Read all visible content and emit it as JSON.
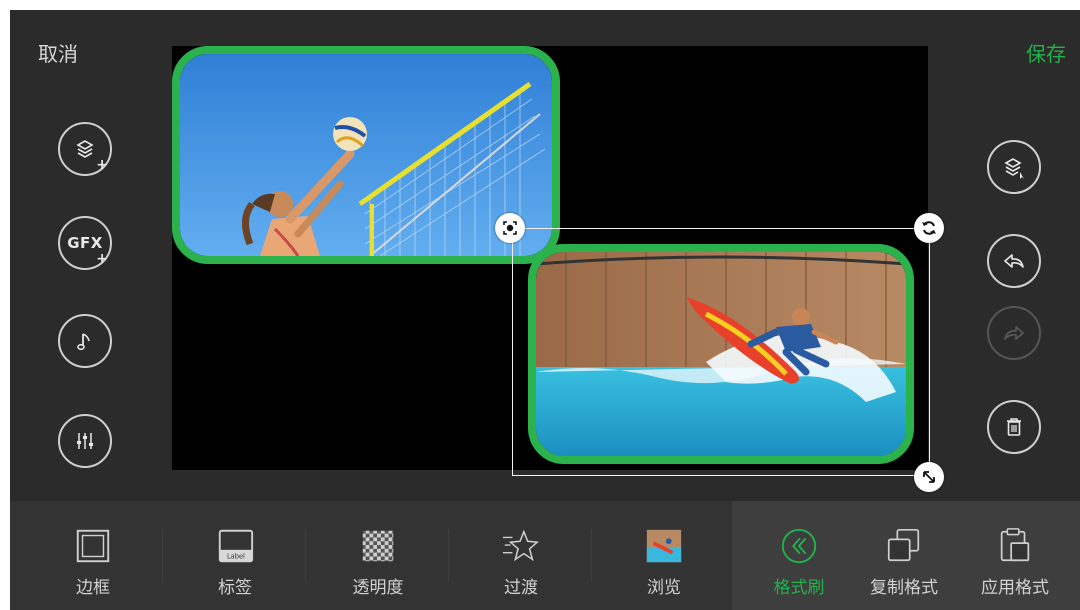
{
  "header": {
    "cancel_label": "取消",
    "save_label": "保存"
  },
  "left_tools": [
    {
      "name": "add-layer",
      "icon": "layers-plus-icon"
    },
    {
      "name": "add-gfx",
      "icon": "gfx-plus-icon",
      "text": "GFX"
    },
    {
      "name": "music",
      "icon": "music-note-icon"
    },
    {
      "name": "audio-mixer",
      "icon": "sliders-icon"
    }
  ],
  "right_tools": [
    {
      "name": "select-layer",
      "icon": "layers-pointer-icon"
    },
    {
      "name": "undo",
      "icon": "undo-icon"
    },
    {
      "name": "redo",
      "icon": "redo-icon",
      "disabled": true
    },
    {
      "name": "delete",
      "icon": "trash-icon"
    }
  ],
  "canvas": {
    "clips": [
      {
        "name": "volleyball-clip",
        "subject": "beach volleyball player",
        "border_color": "#2bb24c"
      },
      {
        "name": "surfer-clip",
        "subject": "surfer on wave",
        "border_color": "#2bb24c",
        "selected": true
      }
    ],
    "handles": [
      "center-icon",
      "rotate-icon",
      "resize-icon"
    ]
  },
  "toolbar": {
    "items": [
      {
        "label": "边框",
        "icon": "frame-icon"
      },
      {
        "label": "标签",
        "icon": "label-icon",
        "icon_text": "Label"
      },
      {
        "label": "透明度",
        "icon": "transparency-icon"
      },
      {
        "label": "过渡",
        "icon": "star-transition-icon"
      },
      {
        "label": "浏览",
        "icon": "thumbnail-icon"
      },
      {
        "label": "格式刷",
        "icon": "format-brush-icon",
        "active": true
      },
      {
        "label": "复制格式",
        "icon": "copy-format-icon"
      },
      {
        "label": "应用格式",
        "icon": "apply-format-icon"
      }
    ]
  },
  "colors": {
    "accent": "#22b14c",
    "background": "#2b2b2b",
    "toolbar": "#333333",
    "canvas": "#000000"
  }
}
